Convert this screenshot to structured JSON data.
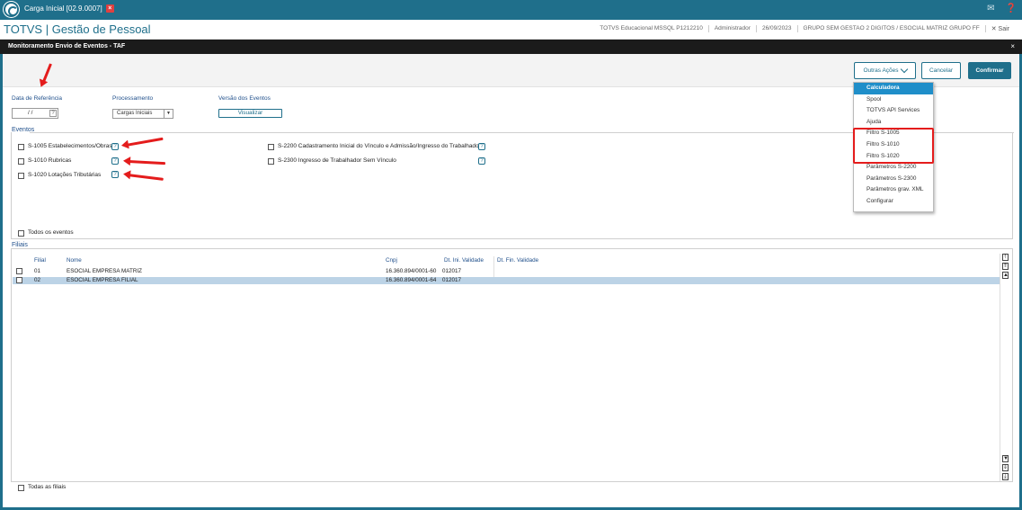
{
  "titlebar": {
    "tab_label": "Carga Inicial [02.9.0007]",
    "close_glyph": "×",
    "icons": [
      "mail-icon",
      "help-icon"
    ]
  },
  "appbar": {
    "title": "TOTVS | Gestão de Pessoal",
    "env": "TOTVS Educacional MSSQL P1212210",
    "user": "Administrador",
    "date": "26/09/2023",
    "group": "GRUPO SEM GESTAO 2 DIGITOS / ESOCIAL MATRIZ GRUPO FF",
    "sair": "✕ Sair"
  },
  "dialog": {
    "title": "Monitoramento Envio de Eventos - TAF",
    "close": "×"
  },
  "toolbar": {
    "outras_acoes": "Outras Ações",
    "cancelar": "Cancelar",
    "confirmar": "Confirmar"
  },
  "menu": {
    "items": [
      {
        "label": "Calculadora",
        "selected": true
      },
      {
        "label": "Spool"
      },
      {
        "label": "TOTVS API Services"
      },
      {
        "label": "Ajuda"
      },
      {
        "label": "Filtro S-1005"
      },
      {
        "label": "Filtro S-1010"
      },
      {
        "label": "Filtro S-1020"
      },
      {
        "label": "Parâmetros S-2200"
      },
      {
        "label": "Parâmetros S-2300"
      },
      {
        "label": "Parâmetros grav. XML"
      },
      {
        "label": "Configurar"
      }
    ]
  },
  "form": {
    "data_ref_label": "Data de Referência",
    "data_ref_value": "/ /",
    "help": "?",
    "processamento_label": "Processamento",
    "processamento_value": "Cargas Iniciais",
    "versao_label": "Versão dos Eventos",
    "visualizar": "Visualizar"
  },
  "eventos": {
    "section_label": "Eventos",
    "items": [
      {
        "label": "S-1005 Estabelecimentos/Obras"
      },
      {
        "label": "S-1010 Rubricas"
      },
      {
        "label": "S-1020 Lotações Tributárias"
      },
      {
        "label": "S-2200 Cadastramento Inicial do Vínculo e Admissão/Ingresso do Trabalhador"
      },
      {
        "label": "S-2300 Ingresso de Trabalhador Sem Vínculo"
      }
    ],
    "todos": "Todos os eventos"
  },
  "filiais": {
    "section_label": "Filiais",
    "columns": [
      "Filial",
      "Nome",
      "Cnpj",
      "Dt. Ini. Validade",
      "Dt. Fin. Validade"
    ],
    "rows": [
      {
        "filial": "01",
        "nome": "ESOCIAL EMPRESA MATRIZ",
        "cnpj": "16.360.894/0001-60",
        "dt_ini": "012017",
        "dt_fin": "",
        "selected": false
      },
      {
        "filial": "02",
        "nome": "ESOCIAL EMPRESA FILIAL",
        "cnpj": "16.360.894/0001-64",
        "dt_ini": "012017",
        "dt_fin": "",
        "selected": true
      }
    ],
    "todas": "Todas as filiais"
  },
  "colors": {
    "brand": "#1f6f8b",
    "annotation_red": "#e41c1c",
    "menu_highlight": "#1f8ec9",
    "row_selected": "#bcd3e6"
  }
}
